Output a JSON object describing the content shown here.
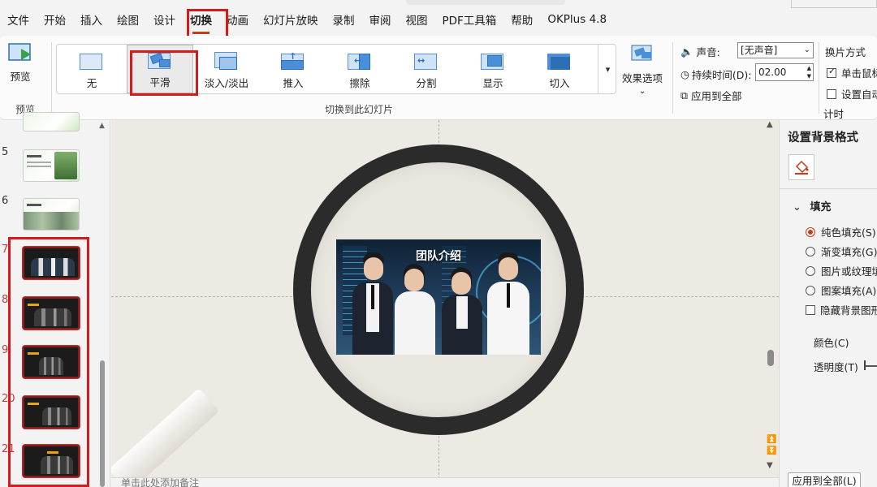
{
  "menu": {
    "items": [
      "文件",
      "开始",
      "插入",
      "绘图",
      "设计",
      "切换",
      "动画",
      "幻灯片放映",
      "录制",
      "审阅",
      "视图",
      "PDF工具箱",
      "帮助",
      "OKPlus 4.8"
    ],
    "active": "切换"
  },
  "ribbon": {
    "preview_label": "预览",
    "preview_group_label": "预览",
    "transitions": [
      "无",
      "平滑",
      "淡入/淡出",
      "推入",
      "擦除",
      "分割",
      "显示",
      "切入"
    ],
    "selected_transition": "平滑",
    "effect_options_label": "效果选项",
    "transition_group_label": "切换到此幻灯片",
    "sound_label": "声音:",
    "sound_value": "[无声音]",
    "duration_label": "持续时间(D):",
    "duration_value": "02.00",
    "apply_all_label": "应用到全部",
    "advance_title": "换片方式",
    "on_click_label": "单击鼠标",
    "after_label": "设置自动",
    "timing_group_label": "计时"
  },
  "slides": {
    "numbers": [
      "5",
      "6",
      "7",
      "8",
      "9",
      "20",
      "21"
    ]
  },
  "canvas": {
    "photo_title": "团队介绍",
    "notes_placeholder": "单击此处添加备注"
  },
  "format_pane": {
    "title": "设置背景格式",
    "fill_section": "填充",
    "fill_options": [
      "纯色填充(S)",
      "渐变填充(G)",
      "图片或纹理填",
      "图案填充(A)"
    ],
    "selected_fill": "纯色填充(S)",
    "hide_bg_label": "隐藏背景图形",
    "color_label": "颜色(C)",
    "transparency_label": "透明度(T)",
    "apply_all_button": "应用到全部(L)"
  },
  "colors": {
    "accent": "#c43e1c",
    "highlight": "#d61a1a"
  }
}
